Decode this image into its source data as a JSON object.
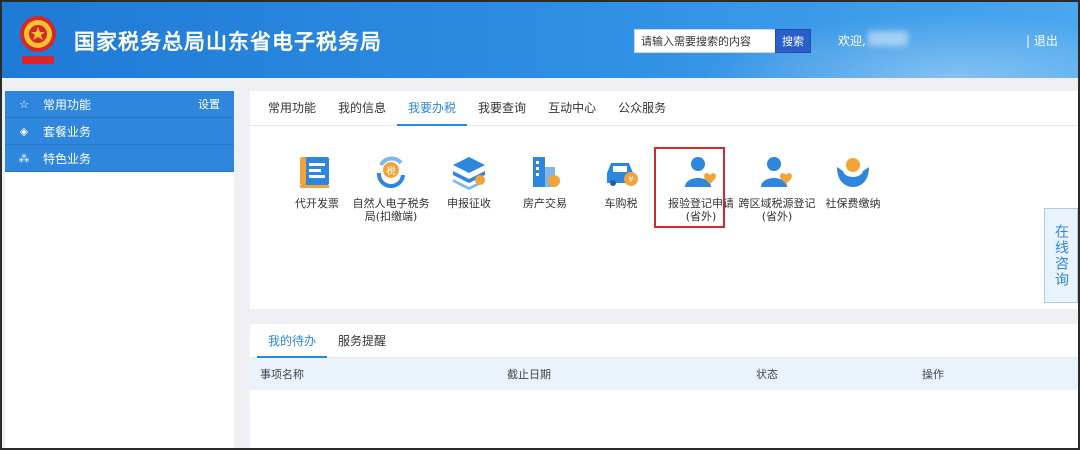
{
  "header": {
    "site_title": "国家税务总局山东省电子税务局",
    "search_placeholder": "请输入需要搜索的内容",
    "search_button": "搜索",
    "welcome": "欢迎,",
    "logout": "| 退出"
  },
  "sidebar": {
    "items": [
      {
        "label": "常用功能",
        "icon": "star-icon",
        "extra": "设置"
      },
      {
        "label": "套餐业务",
        "icon": "layers-icon"
      },
      {
        "label": "特色业务",
        "icon": "grid-icon"
      }
    ]
  },
  "main": {
    "tabs": [
      "常用功能",
      "我的信息",
      "我要办税",
      "我要查询",
      "互动中心",
      "公众服务"
    ],
    "active_tab": "我要办税",
    "services": [
      {
        "label": "代开发票",
        "icon": "invoice-icon"
      },
      {
        "label": "自然人电子税务局(扣缴端)",
        "icon": "tax-icon"
      },
      {
        "label": "申报征收",
        "icon": "stack-icon"
      },
      {
        "label": "房产交易",
        "icon": "building-icon"
      },
      {
        "label": "车购税",
        "icon": "car-icon"
      },
      {
        "label": "报验登记申请(省外)",
        "icon": "person-heart-icon"
      },
      {
        "label": "跨区域税源登记(省外)",
        "icon": "person-heart-icon"
      },
      {
        "label": "社保费缴纳",
        "icon": "hands-globe-icon"
      }
    ],
    "consult_label": "在线咨询"
  },
  "todo": {
    "tabs": [
      "我的待办",
      "服务提醒"
    ],
    "columns": [
      "事项名称",
      "截止日期",
      "状态",
      "操作"
    ]
  },
  "colors": {
    "header_blue": "#2f8fe3",
    "sidebar_blue": "#2f86dd",
    "accent": "#2f86dd",
    "highlight_red": "#d9262b",
    "icon_orange": "#f2a33a"
  }
}
